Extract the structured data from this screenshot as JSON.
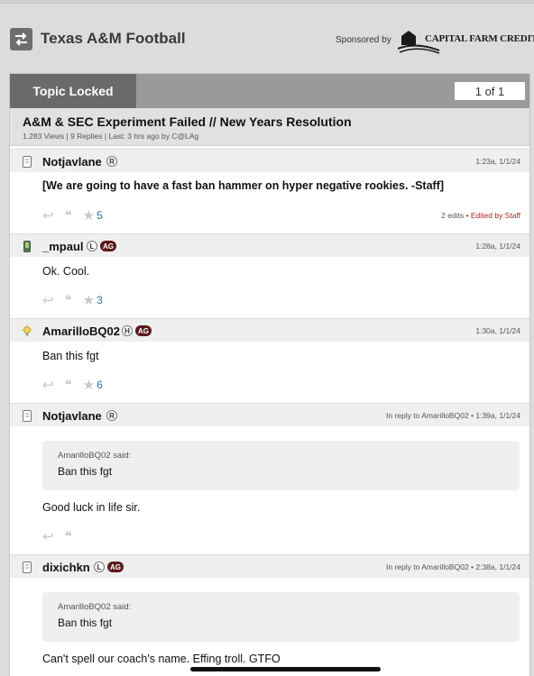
{
  "header": {
    "site_title": "Texas A&M Football",
    "sponsored_by": "Sponsored by",
    "sponsor_name": "CAPITAL FARM CREDIT"
  },
  "topic": {
    "lock_label": "Topic Locked",
    "page_select": "1 of 1",
    "title": "A&M & SEC Experiment Failed // New Years Resolution",
    "meta": "1,283 Views | 9 Replies | Last: 3 hrs ago by C@LAg"
  },
  "posts": [
    {
      "username": "Notjavlane",
      "badge": "R",
      "time": "1:23a, 1/1/24",
      "body": "[We are going to have a fast ban hammer on hyper negative rookies. -Staff]",
      "stars": "5",
      "edits": "2 edits",
      "edit_sep": " • ",
      "edited_by": "Edited by Staff"
    },
    {
      "username": "_mpaul",
      "badge": "L",
      "ag": "AG",
      "time": "1:28a, 1/1/24",
      "body": "Ok. Cool.",
      "stars": "3"
    },
    {
      "username": "AmarilloBQ02",
      "badge": "H",
      "ag": "AG",
      "time": "1:30a, 1/1/24",
      "body": "Ban this fgt",
      "stars": "6"
    },
    {
      "username": "Notjavlane",
      "badge": "R",
      "time": "In reply to AmarilloBQ02 • 1:39a, 1/1/24",
      "quote_who": "AmarilloBQ02 said:",
      "quote_text": "Ban this fgt",
      "body": "Good luck in life sir."
    },
    {
      "username": "dixichkn",
      "badge": "L",
      "ag": "AG",
      "time": "In reply to AmarilloBQ02 • 2:38a, 1/1/24",
      "quote_who": "AmarilloBQ02 said:",
      "quote_text": "Ban this fgt",
      "body": "Can't spell our coach's name. Effing troll. GTFO"
    }
  ],
  "icons": {
    "back": "swap-arrows-icon",
    "reply": "reply-icon",
    "quote": "quote-icon",
    "star": "star-icon",
    "avatar_device": "tablet-icon",
    "avatar_phone": "phone-icon",
    "avatar_bulb": "lightbulb-icon"
  },
  "colors": {
    "ag_badge": "#5a1a1a",
    "star_count": "#2f6f9f",
    "edited_by_staff": "#b02020"
  }
}
